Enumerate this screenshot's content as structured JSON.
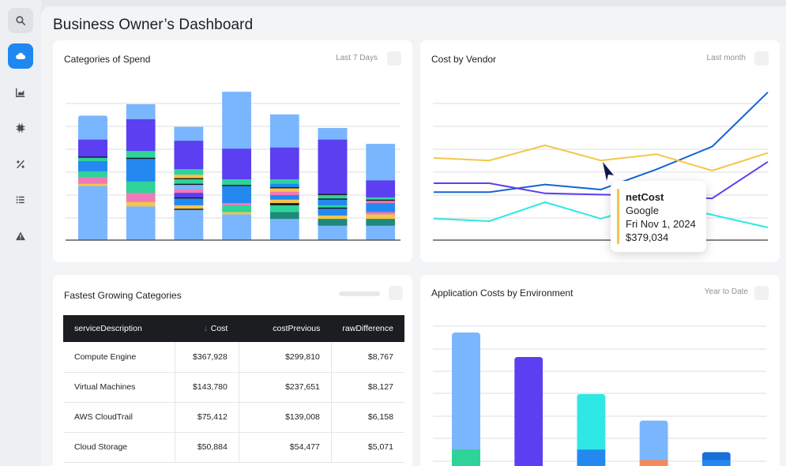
{
  "page": {
    "title": "Business Owner’s Dashboard"
  },
  "sidebar": {
    "items": [
      {
        "icon": "search-icon",
        "active": false
      },
      {
        "icon": "cloud-icon",
        "active": true
      },
      {
        "icon": "bar-chart-icon",
        "active": false
      },
      {
        "icon": "chip-icon",
        "active": false
      },
      {
        "icon": "percent-icon",
        "active": false
      },
      {
        "icon": "list-icon",
        "active": false
      },
      {
        "icon": "warning-icon",
        "active": false
      }
    ]
  },
  "cards": {
    "spend": {
      "title": "Categories of Spend",
      "period": "Last 7 Days"
    },
    "vendor": {
      "title": "Cost by Vendor",
      "period": "Last month"
    },
    "growing": {
      "title": "Fastest Growing Categories"
    },
    "environment": {
      "title": "Application Costs by Environment",
      "period": "Year to Date"
    }
  },
  "table": {
    "columns": [
      "serviceDescription",
      "Cost",
      "costPrevious",
      "rawDifference"
    ],
    "sorted_column": "Cost",
    "rows": [
      [
        "Compute Engine",
        "$367,928",
        "$299,810",
        "$8,767"
      ],
      [
        "Virtual Machines",
        "$143,780",
        "$237,651",
        "$8,127"
      ],
      [
        "AWS CloudTrail",
        "$75,412",
        "$139,008",
        "$6,158"
      ],
      [
        "Cloud Storage",
        "$50,884",
        "$54,477",
        "$5,071"
      ]
    ]
  },
  "tooltip": {
    "series": "netCost",
    "vendor": "Google",
    "date": "Fri Nov 1, 2024",
    "value": "$379,034"
  },
  "colors": {
    "accent": "#1e87f0",
    "light_blue": "#7ab6fd",
    "purple": "#5b3ff0",
    "teal_green": "#2fd39a",
    "blue": "#2389f0",
    "pink": "#f07ab8",
    "yellow": "#f5c54a",
    "cyan": "#2ee8e6",
    "orange": "#f5895a"
  },
  "chart_data": [
    {
      "type": "bar",
      "stacked": true,
      "grid": true,
      "ylim": [
        0,
        68
      ],
      "columns": [
        {
          "total": 55,
          "segments": [
            {
              "color": "#7ab6fd",
              "value": 24
            },
            {
              "color": "#f5c54a",
              "value": 1
            },
            {
              "color": "#f07ab8",
              "value": 3
            },
            {
              "color": "#2fd39a",
              "value": 2.5
            },
            {
              "color": "#2389f0",
              "value": 4.5
            },
            {
              "color": "#2fd39a",
              "value": 1.5
            },
            {
              "color": "#1b1d21",
              "value": 0.5
            },
            {
              "color": "#5b3ff0",
              "value": 7.5
            },
            {
              "color": "#7ab6fd",
              "value": 10.5
            }
          ]
        },
        {
          "total": 62,
          "segments": [
            {
              "color": "#7ab6fd",
              "value": 15
            },
            {
              "color": "#f5c54a",
              "value": 2
            },
            {
              "color": "#f07ab8",
              "value": 4
            },
            {
              "color": "#2fd39a",
              "value": 5
            },
            {
              "color": "#2389f0",
              "value": 10
            },
            {
              "color": "#1b1d21",
              "value": 0.5
            },
            {
              "color": "#2fd39a",
              "value": 3
            },
            {
              "color": "#5b3ff0",
              "value": 14
            },
            {
              "color": "#7ab6fd",
              "value": 6.5
            }
          ]
        },
        {
          "total": 56,
          "segments": [
            {
              "color": "#7ab6fd",
              "value": 13.5
            },
            {
              "color": "#1b1d21",
              "value": 0.5
            },
            {
              "color": "#f5c54a",
              "value": 1.5
            },
            {
              "color": "#2389f0",
              "value": 3
            },
            {
              "color": "#1b1d21",
              "value": 0.5
            },
            {
              "color": "#5b3ff0",
              "value": 2
            },
            {
              "color": "#f07ab8",
              "value": 1.5
            },
            {
              "color": "#7ab6fd",
              "value": 2
            },
            {
              "color": "#1b1d21",
              "value": 0.5
            },
            {
              "color": "#2fd39a",
              "value": 2
            },
            {
              "color": "#1b1d21",
              "value": 0.5
            },
            {
              "color": "#f5c54a",
              "value": 1.5
            },
            {
              "color": "#2fd39a",
              "value": 2.5
            },
            {
              "color": "#5b3ff0",
              "value": 12.5
            },
            {
              "color": "#7ab6fd",
              "value": 6
            }
          ]
        },
        {
          "total": 69,
          "segments": [
            {
              "color": "#7ab6fd",
              "value": 11.5
            },
            {
              "color": "#f5c54a",
              "value": 1
            },
            {
              "color": "#2fd39a",
              "value": 3
            },
            {
              "color": "#f07ab8",
              "value": 1
            },
            {
              "color": "#2389f0",
              "value": 7.5
            },
            {
              "color": "#1b1d21",
              "value": 0.5
            },
            {
              "color": "#2fd39a",
              "value": 2.5
            },
            {
              "color": "#5b3ff0",
              "value": 13.5
            },
            {
              "color": "#7ab6fd",
              "value": 25
            }
          ]
        },
        {
          "total": 58.5,
          "segments": [
            {
              "color": "#7ab6fd",
              "value": 9.5
            },
            {
              "color": "#1d8a7a",
              "value": 3
            },
            {
              "color": "#2fd39a",
              "value": 3
            },
            {
              "color": "#1b1d21",
              "value": 1
            },
            {
              "color": "#f5c54a",
              "value": 1.5
            },
            {
              "color": "#2389f0",
              "value": 2
            },
            {
              "color": "#f07ab8",
              "value": 1.5
            },
            {
              "color": "#f5c54a",
              "value": 1.5
            },
            {
              "color": "#1b1d21",
              "value": 0.5
            },
            {
              "color": "#2389f0",
              "value": 1.5
            },
            {
              "color": "#2fd39a",
              "value": 2
            },
            {
              "color": "#5b3ff0",
              "value": 14
            },
            {
              "color": "#7ab6fd",
              "value": 14.5
            }
          ]
        },
        {
          "total": 51.5,
          "segments": [
            {
              "color": "#7ab6fd",
              "value": 6.5
            },
            {
              "color": "#1d8a7a",
              "value": 3
            },
            {
              "color": "#f5c54a",
              "value": 1.5
            },
            {
              "color": "#2389f0",
              "value": 3
            },
            {
              "color": "#1b1d21",
              "value": 0.5
            },
            {
              "color": "#2fd39a",
              "value": 1
            },
            {
              "color": "#2389f0",
              "value": 2.5
            },
            {
              "color": "#1b1d21",
              "value": 0.5
            },
            {
              "color": "#2fd39a",
              "value": 1.5
            },
            {
              "color": "#1b1d21",
              "value": 0.5
            },
            {
              "color": "#5b3ff0",
              "value": 24
            },
            {
              "color": "#7ab6fd",
              "value": 5
            }
          ]
        },
        {
          "total": 46,
          "segments": [
            {
              "color": "#7ab6fd",
              "value": 6.5
            },
            {
              "color": "#1d8a7a",
              "value": 3
            },
            {
              "color": "#f5c54a",
              "value": 2
            },
            {
              "color": "#f07ab8",
              "value": 1
            },
            {
              "color": "#2389f0",
              "value": 4
            },
            {
              "color": "#f07ab8",
              "value": 1
            },
            {
              "color": "#1b1d21",
              "value": 0.5
            },
            {
              "color": "#2fd39a",
              "value": 1
            },
            {
              "color": "#5b3ff0",
              "value": 7.5
            },
            {
              "color": "#7ab6fd",
              "value": 16
            }
          ]
        }
      ]
    },
    {
      "type": "line",
      "grid": true,
      "ylim": [
        0,
        100
      ],
      "x": [
        0,
        1,
        2,
        3,
        4,
        5,
        6
      ],
      "series": [
        {
          "color": "#1565d0",
          "values": [
            33,
            33,
            39,
            35,
            51,
            69,
            112
          ]
        },
        {
          "color": "#f5c54a",
          "values": [
            60,
            58,
            70,
            58,
            63,
            50,
            64
          ]
        },
        {
          "color": "#5b3ff0",
          "values": [
            40,
            40,
            32,
            31,
            30,
            28,
            57
          ]
        },
        {
          "color": "#2ee8e6",
          "values": [
            12,
            10,
            25,
            12,
            25,
            15,
            5
          ]
        }
      ]
    },
    {
      "type": "bar",
      "stacked": true,
      "grid": true,
      "ylim": [
        0,
        100
      ],
      "columns": [
        {
          "total": 100,
          "segments": [
            {
              "color": "#2fd39a",
              "value": 16.5
            },
            {
              "color": "#7ab6fd",
              "value": 83.5
            }
          ]
        },
        {
          "total": 82.5,
          "segments": [
            {
              "color": "#f5895a",
              "value": 3
            },
            {
              "color": "#5b3ff0",
              "value": 79.5
            }
          ]
        },
        {
          "total": 56,
          "segments": [
            {
              "color": "#2389f0",
              "value": 16.5
            },
            {
              "color": "#2ee8e6",
              "value": 39.5
            }
          ]
        },
        {
          "total": 37,
          "segments": [
            {
              "color": "#f5895a",
              "value": 9
            },
            {
              "color": "#7ab6fd",
              "value": 28
            }
          ]
        },
        {
          "total": 14.5,
          "segments": [
            {
              "color": "#2389f0",
              "value": 9
            },
            {
              "color": "#1a6fd8",
              "value": 5.5
            }
          ]
        }
      ]
    }
  ]
}
